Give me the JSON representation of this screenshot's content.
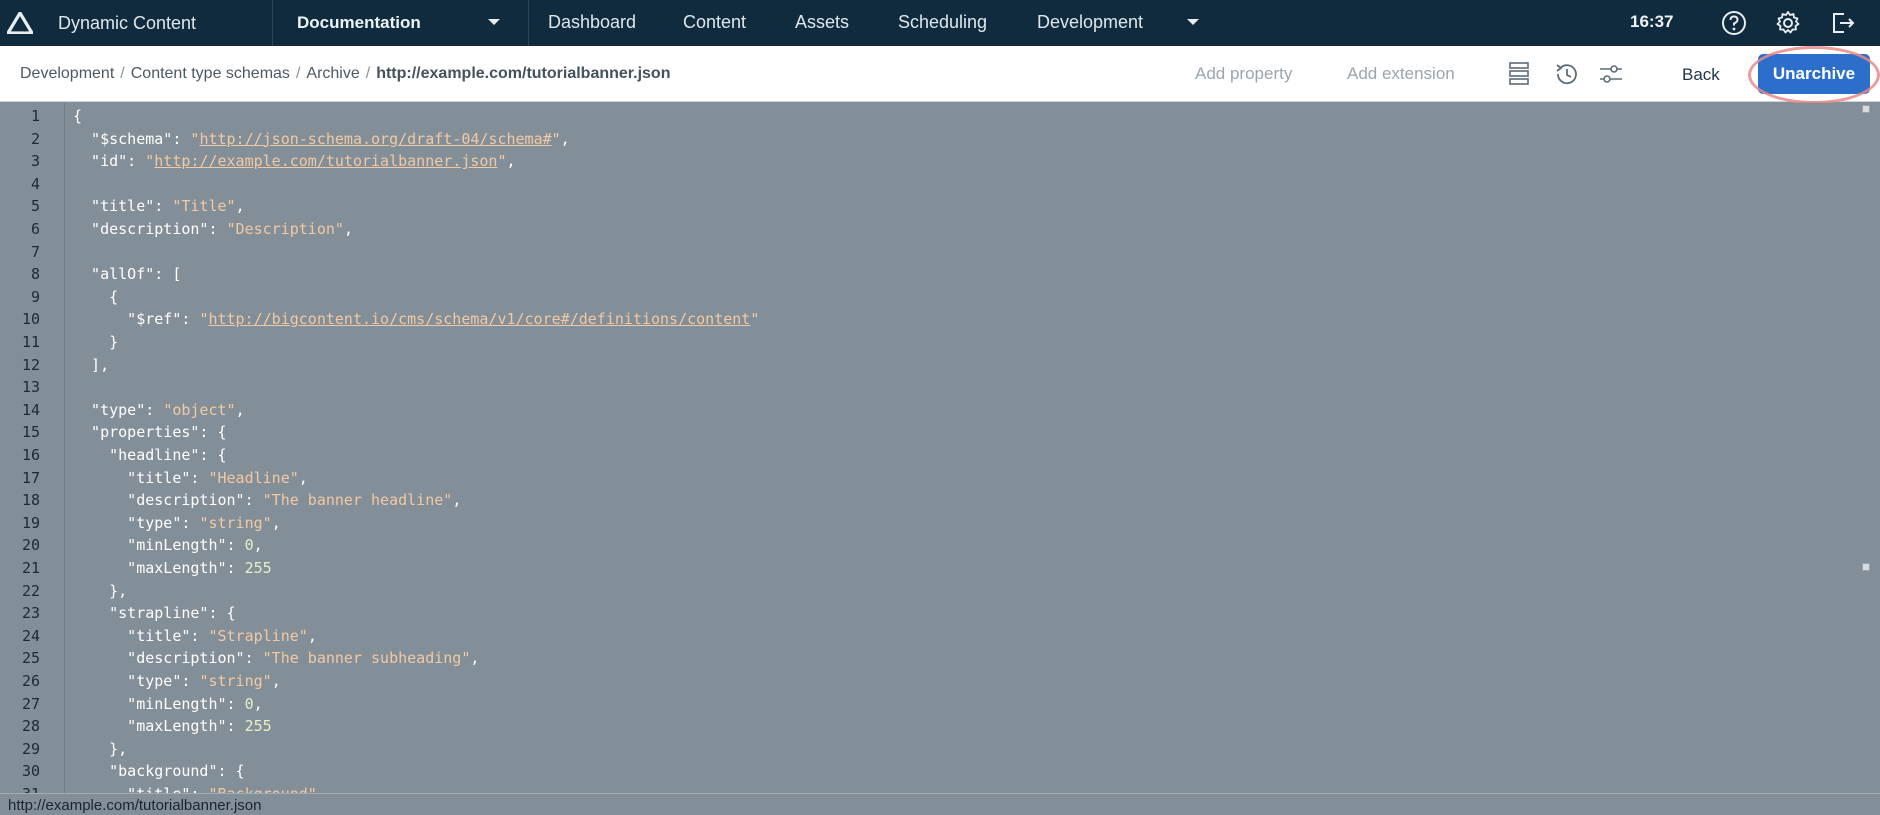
{
  "app": {
    "name": "Dynamic Content",
    "hub": "Documentation",
    "nav": [
      "Dashboard",
      "Content",
      "Assets",
      "Scheduling",
      "Development"
    ],
    "clock": "16:37"
  },
  "breadcrumb": {
    "items": [
      "Development",
      "Content type schemas",
      "Archive"
    ],
    "current": "http://example.com/tutorialbanner.json"
  },
  "toolbar": {
    "add_property": "Add property",
    "add_extension": "Add extension",
    "back": "Back",
    "unarchive": "Unarchive",
    "icons": [
      "list-view-icon",
      "history-icon",
      "settings-sliders-icon"
    ]
  },
  "colors": {
    "nav_bg": "#0f2b3d",
    "primary_button": "#2b6fcb",
    "editor_bg": "#838f98",
    "highlight_ring": "#e98a8a"
  },
  "editor": {
    "lines": [
      "{",
      "  \"$schema\": \"http://json-schema.org/draft-04/schema#\",",
      "  \"id\": \"http://example.com/tutorialbanner.json\",",
      "",
      "  \"title\": \"Title\",",
      "  \"description\": \"Description\",",
      "",
      "  \"allOf\": [",
      "    {",
      "      \"$ref\": \"http://bigcontent.io/cms/schema/v1/core#/definitions/content\"",
      "    }",
      "  ],",
      "",
      "  \"type\": \"object\",",
      "  \"properties\": {",
      "    \"headline\": {",
      "      \"title\": \"Headline\",",
      "      \"description\": \"The banner headline\",",
      "      \"type\": \"string\",",
      "      \"minLength\": 0,",
      "      \"maxLength\": 255",
      "    },",
      "    \"strapline\": {",
      "      \"title\": \"Strapline\",",
      "      \"description\": \"The banner subheading\",",
      "      \"type\": \"string\",",
      "      \"minLength\": 0,",
      "      \"maxLength\": 255",
      "    },",
      "    \"background\": {",
      "      \"title\": \"Background\","
    ]
  },
  "status_bar": {
    "url": "http://example.com/tutorialbanner.json"
  }
}
